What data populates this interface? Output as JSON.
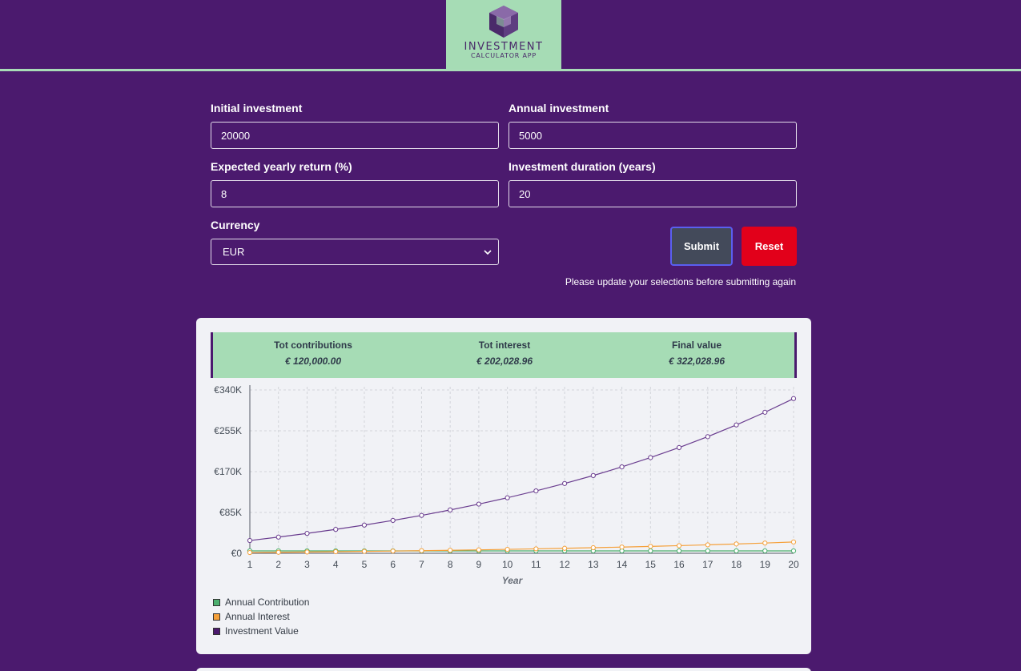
{
  "header": {
    "logo_title": "INVESTMENT",
    "logo_subtitle": "CALCULATOR APP"
  },
  "form": {
    "initial_label": "Initial investment",
    "initial_value": "20000",
    "annual_label": "Annual investment",
    "annual_value": "5000",
    "return_label": "Expected yearly return (%)",
    "return_value": "8",
    "duration_label": "Investment duration (years)",
    "duration_value": "20",
    "currency_label": "Currency",
    "currency_value": "EUR",
    "submit_label": "Submit",
    "reset_label": "Reset",
    "hint": "Please update your selections before submitting again"
  },
  "summary": {
    "contrib_label": "Tot contributions",
    "contrib_value": "€ 120,000.00",
    "interest_label": "Tot interest",
    "interest_value": "€ 202,028.96",
    "final_label": "Final value",
    "final_value": "€ 322,028.96"
  },
  "colors": {
    "contribution": "#4caf6e",
    "interest": "#f5a03a",
    "value": "#6a3d8f"
  },
  "chart_data": {
    "type": "line",
    "title": "",
    "xlabel": "Year",
    "ylabel": "",
    "x": [
      1,
      2,
      3,
      4,
      5,
      6,
      7,
      8,
      9,
      10,
      11,
      12,
      13,
      14,
      15,
      16,
      17,
      18,
      19,
      20
    ],
    "ylim": [
      0,
      340000
    ],
    "y_ticks": [
      "€0",
      "€85K",
      "€170K",
      "€255K",
      "€340K"
    ],
    "y_tick_values": [
      0,
      85000,
      170000,
      255000,
      340000
    ],
    "grid": true,
    "legend_position": "bottom-left",
    "series": [
      {
        "name": "Annual Contribution",
        "color": "#4caf6e",
        "values": [
          5000,
          5000,
          5000,
          5000,
          5000,
          5000,
          5000,
          5000,
          5000,
          5000,
          5000,
          5000,
          5000,
          5000,
          5000,
          5000,
          5000,
          5000,
          5000,
          5000
        ]
      },
      {
        "name": "Annual Interest",
        "color": "#f5a03a",
        "values": [
          1600,
          2128,
          2698,
          3314,
          3979,
          4698,
          5474,
          6312,
          7217,
          8194,
          9250,
          10390,
          11621,
          12951,
          14387,
          15938,
          17613,
          19422,
          21376,
          23486
        ]
      },
      {
        "name": "Investment Value",
        "color": "#6a3d8f",
        "values": [
          26600,
          33728,
          41426,
          49740,
          58719,
          68417,
          78890,
          90201,
          102418,
          115612,
          129861,
          145250,
          161871,
          179821,
          199208,
          220145,
          242757,
          267178,
          293552,
          322029
        ]
      }
    ]
  }
}
